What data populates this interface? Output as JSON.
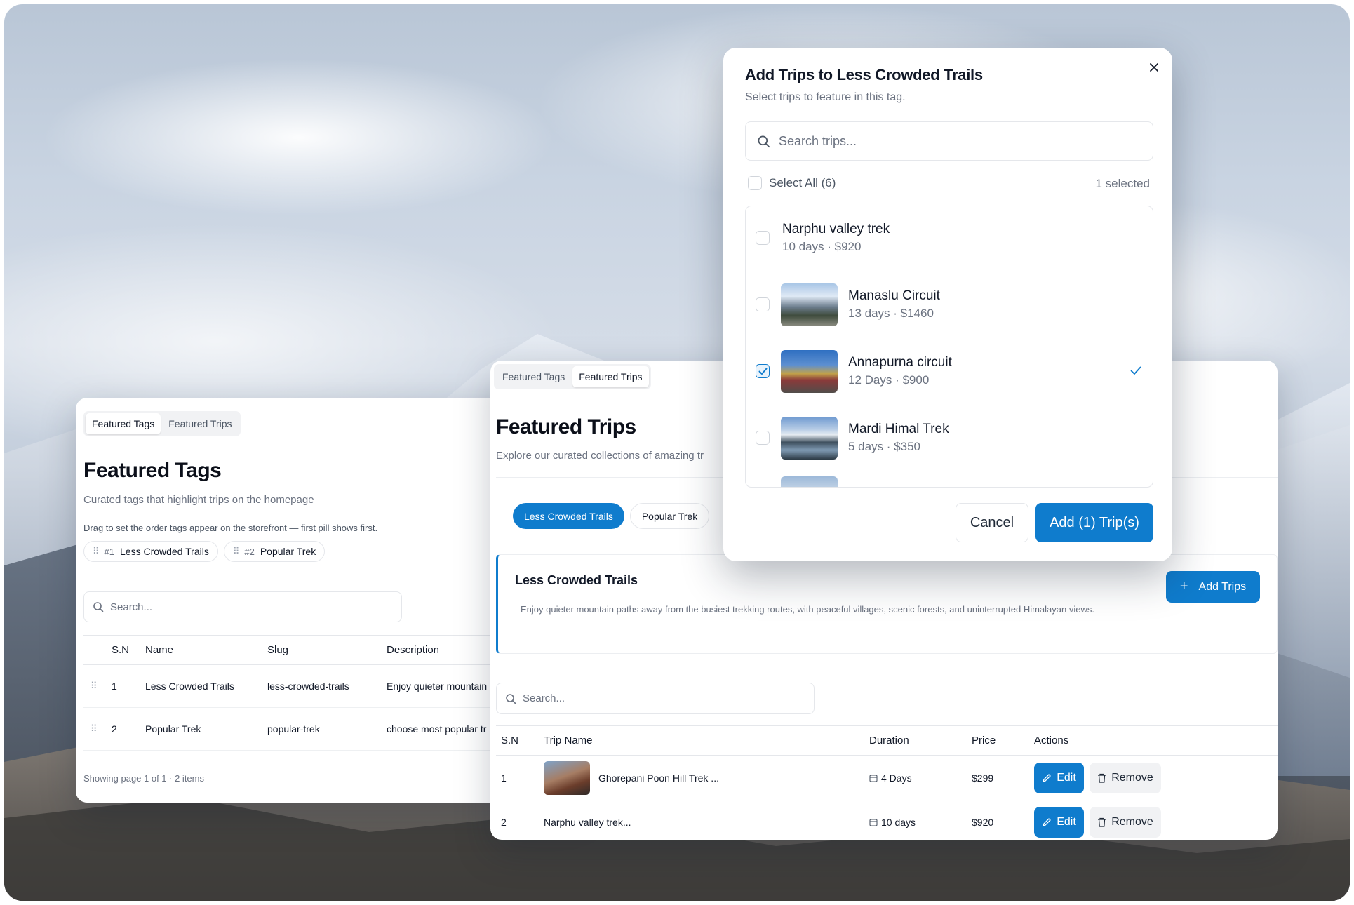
{
  "colors": {
    "accent": "#0f7ccd",
    "text": "#111827",
    "muted": "#6b7280",
    "border": "#e5e7eb"
  },
  "tags_panel": {
    "tabs": [
      "Featured Tags",
      "Featured Trips"
    ],
    "title": "Featured Tags",
    "subtitle": "Curated tags that highlight trips on the homepage",
    "order_hint": "Drag to set the order tags appear on the storefront — first pill shows first.",
    "pills": [
      {
        "rank": "#1",
        "label": "Less Crowded Trails"
      },
      {
        "rank": "#2",
        "label": "Popular Trek"
      }
    ],
    "search_placeholder": "Search...",
    "columns": [
      "S.N",
      "Name",
      "Slug",
      "Description"
    ],
    "rows": [
      {
        "sn": "1",
        "name": "Less Crowded Trails",
        "slug": "less-crowded-trails",
        "description": "Enjoy quieter mountain"
      },
      {
        "sn": "2",
        "name": "Popular Trek",
        "slug": "popular-trek",
        "description": "choose most popular tr"
      }
    ],
    "footer": "Showing page 1 of 1 · 2 items"
  },
  "trips_panel": {
    "tabs": [
      "Featured Tags",
      "Featured Trips"
    ],
    "title": "Featured Trips",
    "subtitle": "Explore our curated collections of amazing tr",
    "tag_pills": [
      "Less Crowded Trails",
      "Popular Trek"
    ],
    "tag_card": {
      "title": "Less Crowded Trails",
      "description": "Enjoy quieter mountain paths away from the busiest trekking routes, with peaceful villages, scenic forests, and uninterrupted Himalayan views.",
      "add_button": "Add Trips"
    },
    "search_placeholder": "Search...",
    "columns": [
      "S.N",
      "Trip Name",
      "Duration",
      "Price",
      "Actions"
    ],
    "rows": [
      {
        "sn": "1",
        "name": "Ghorepani Poon Hill Trek ...",
        "duration": "4 Days",
        "price": "$299",
        "has_thumb": true
      },
      {
        "sn": "2",
        "name": "Narphu valley trek...",
        "duration": "10 days",
        "price": "$920",
        "has_thumb": false
      }
    ],
    "edit_label": "Edit",
    "remove_label": "Remove"
  },
  "modal": {
    "title": "Add Trips to Less Crowded Trails",
    "subtitle": "Select trips to feature in this tag.",
    "search_placeholder": "Search trips...",
    "select_all": "Select All (6)",
    "selected_count": "1 selected",
    "trips": [
      {
        "name": "Narphu valley trek",
        "meta": "10 days · $920",
        "checked": false,
        "thumb": "none"
      },
      {
        "name": "Manaslu Circuit",
        "meta": "13 days · $1460",
        "checked": false,
        "thumb": "mountain-village"
      },
      {
        "name": "Annapurna circuit",
        "meta": "12 Days · $900",
        "checked": true,
        "thumb": "prayer-flags"
      },
      {
        "name": "Mardi Himal Trek",
        "meta": "5 days · $350",
        "checked": false,
        "thumb": "mountain-lake"
      }
    ],
    "cancel_label": "Cancel",
    "submit_label": "Add (1) Trip(s)"
  }
}
